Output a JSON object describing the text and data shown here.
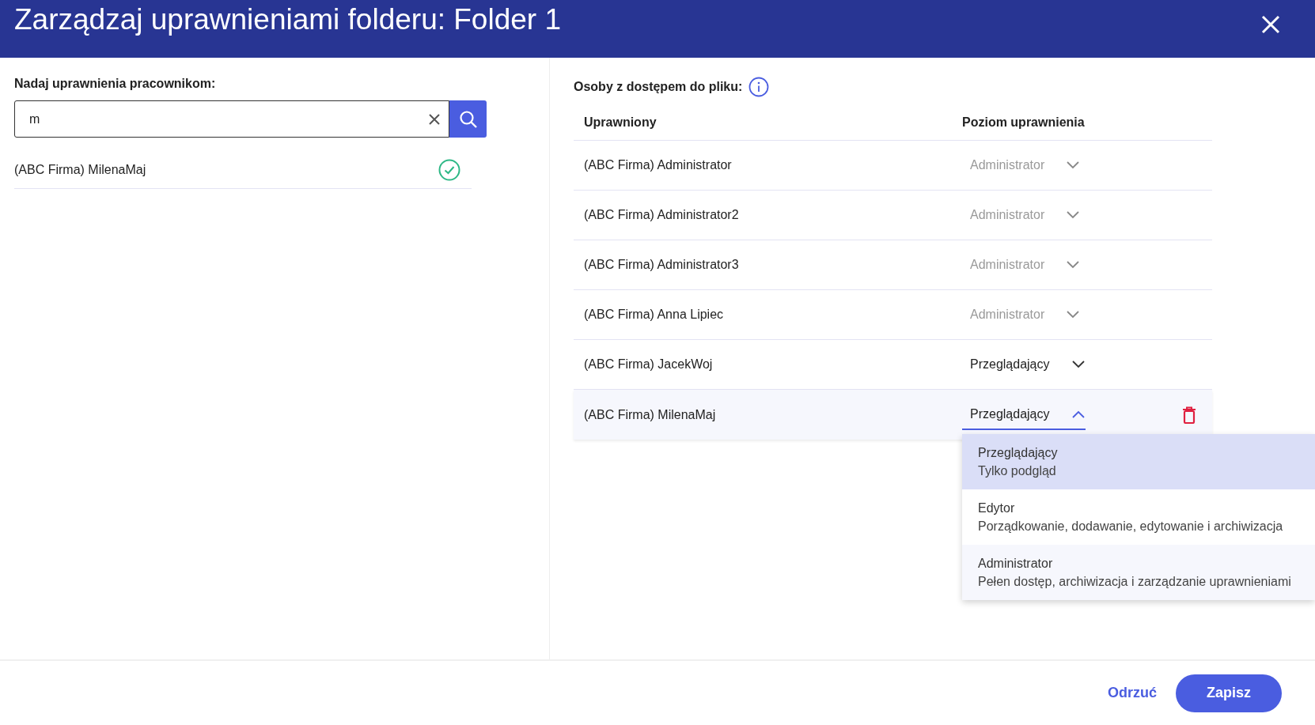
{
  "window": {
    "title": "Zarządzaj uprawnieniami folderu: Folder 1"
  },
  "search_panel": {
    "label": "Nadaj uprawnienia pracownikom:",
    "search": {
      "value": "m"
    },
    "results": [
      {
        "name": "(ABC Firma) MilenaMaj",
        "added": true
      }
    ]
  },
  "access_panel": {
    "label": "Osoby z dostępem do pliku:",
    "columns": [
      "Uprawniony",
      "Poziom uprawnienia"
    ],
    "rows": [
      {
        "name": "(ABC Firma) Administrator",
        "level": "Administrator",
        "disabled": true,
        "expanded": false
      },
      {
        "name": "(ABC Firma) Administrator2",
        "level": "Administrator",
        "disabled": true,
        "expanded": false
      },
      {
        "name": "(ABC Firma) Administrator3",
        "level": "Administrator",
        "disabled": true,
        "expanded": false
      },
      {
        "name": "(ABC Firma) Anna Lipiec",
        "level": "Administrator",
        "disabled": true,
        "expanded": false
      },
      {
        "name": "(ABC Firma) JacekWoj",
        "level": "Przeglądający",
        "disabled": false,
        "expanded": false
      },
      {
        "name": "(ABC Firma) MilenaMaj",
        "level": "Przeglądający",
        "disabled": false,
        "expanded": true
      }
    ],
    "level_menu": {
      "options": [
        {
          "title": "Przeglądający",
          "description": "Tylko podgląd",
          "selected": true
        },
        {
          "title": "Edytor",
          "description": "Porządkowanie, dodawanie, edytowanie i archiwizacja",
          "selected": false
        },
        {
          "title": "Administrator",
          "description": "Pełen dostęp, archiwizacja i zarządzanie uprawnieniami",
          "selected": false
        }
      ]
    }
  },
  "footer": {
    "buttons": [
      {
        "label": "Odrzuć",
        "kind": "text"
      },
      {
        "label": "Zapisz",
        "kind": "primary"
      }
    ]
  }
}
